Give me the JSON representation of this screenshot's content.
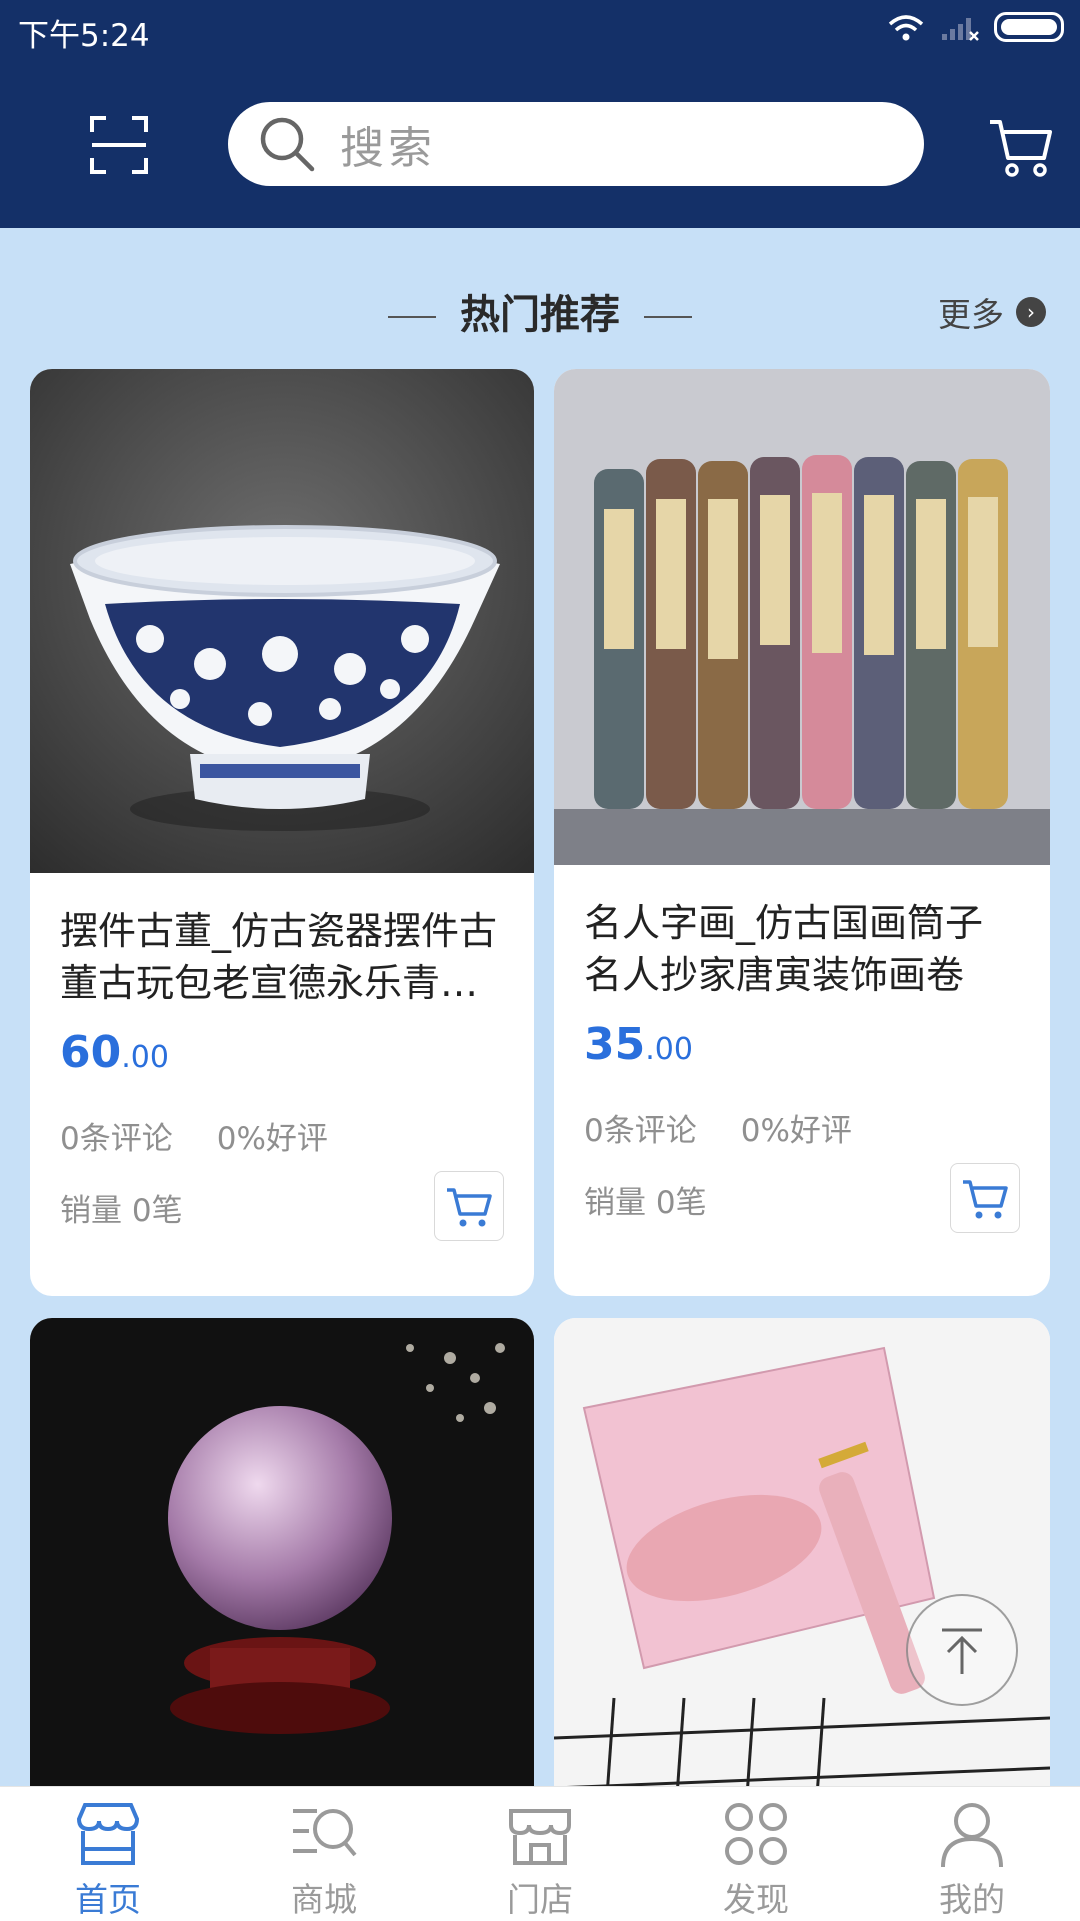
{
  "status_bar": {
    "time": "下午5:24"
  },
  "header": {
    "search_placeholder": "搜索"
  },
  "section": {
    "title": "热门推荐",
    "more_label": "更多"
  },
  "products": [
    {
      "title": "摆件古董_仿古瓷器摆件古董古玩包老宣德永乐青花大碗",
      "price_int": "60",
      "price_dec": ".00",
      "reviews": "0条评论",
      "rating": "0%好评",
      "sales": "销量 0笔"
    },
    {
      "title": "名人字画_仿古国画筒子 名人抄家唐寅装饰画卷",
      "price_int": "35",
      "price_dec": ".00",
      "reviews": "0条评论",
      "rating": "0%好评",
      "sales": "销量 0笔"
    }
  ],
  "tabs": [
    {
      "label": "首页",
      "icon": "store-icon",
      "active": true
    },
    {
      "label": "商城",
      "icon": "search-list-icon"
    },
    {
      "label": "门店",
      "icon": "shop-icon"
    },
    {
      "label": "发现",
      "icon": "grid-icon"
    },
    {
      "label": "我的",
      "icon": "user-icon"
    }
  ],
  "colors": {
    "header_bg": "#143068",
    "page_bg": "#c7e0f7",
    "accent": "#3a7bd5",
    "price": "#2a6fdc"
  }
}
